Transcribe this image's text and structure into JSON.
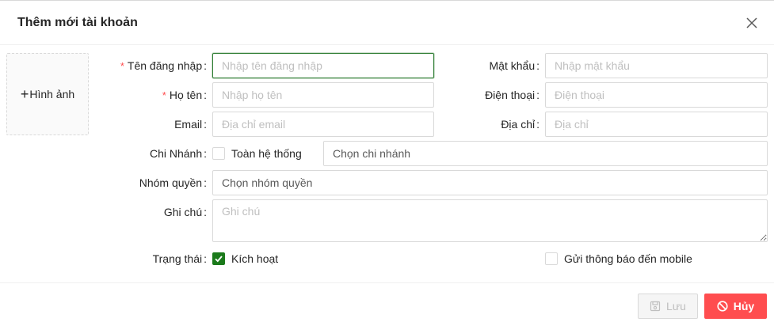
{
  "modal": {
    "title": "Thêm mới tài khoản",
    "upload_label": "Hình ảnh"
  },
  "form": {
    "username": {
      "label": "Tên đăng nhập",
      "placeholder": "Nhập tên đăng nhập",
      "required": true
    },
    "password": {
      "label": "Mật khẩu",
      "placeholder": "Nhập mật khẩu"
    },
    "fullname": {
      "label": "Họ tên",
      "placeholder": "Nhập họ tên",
      "required": true
    },
    "phone": {
      "label": "Điện thoại",
      "placeholder": "Điện thoại"
    },
    "email": {
      "label": "Email",
      "placeholder": "Địa chỉ email"
    },
    "address": {
      "label": "Địa chỉ",
      "placeholder": "Địa chỉ"
    },
    "branch": {
      "label": "Chi Nhánh",
      "all_system_label": "Toàn hệ thống",
      "select_placeholder": "Chọn chi nhánh"
    },
    "role_group": {
      "label": "Nhóm quyền",
      "placeholder": "Chọn nhóm quyền"
    },
    "note": {
      "label": "Ghi chú",
      "placeholder": "Ghi chú"
    },
    "status": {
      "label": "Trạng thái",
      "active_label": "Kích hoạt",
      "active_checked": true,
      "notify_mobile_label": "Gửi thông báo đến mobile",
      "notify_checked": false
    }
  },
  "footer": {
    "save_label": "Lưu",
    "cancel_label": "Hủy"
  },
  "colors": {
    "primary_green": "#1b7a1b",
    "danger": "#ff4d4f",
    "required_mark": "#ff4d4f"
  }
}
